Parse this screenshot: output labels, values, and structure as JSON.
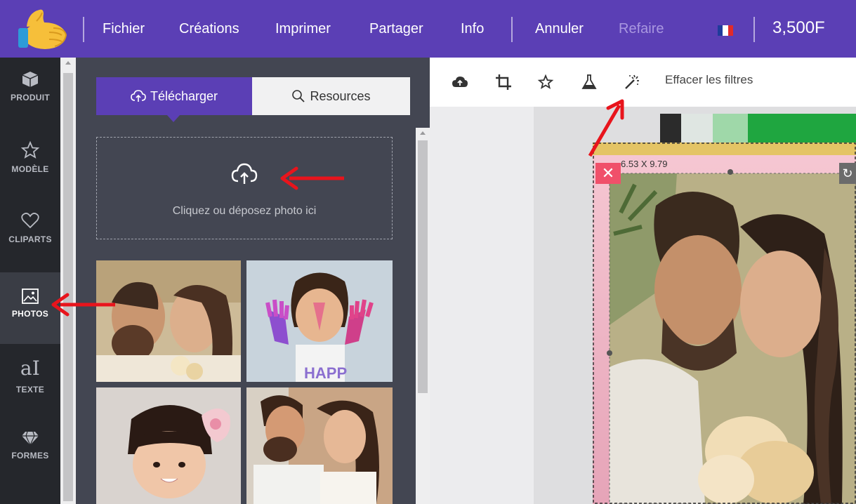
{
  "menu": {
    "file": "Fichier",
    "creations": "Créations",
    "print": "Imprimer",
    "share": "Partager",
    "info": "Info",
    "undo": "Annuler",
    "redo": "Refaire",
    "price": "3,500F"
  },
  "sidebar": {
    "items": [
      {
        "label": "PRODUIT",
        "icon": "cube-icon"
      },
      {
        "label": "MODÈLE",
        "icon": "star-outline-icon"
      },
      {
        "label": "CLIPARTS",
        "icon": "heart-outline-icon"
      },
      {
        "label": "PHOTOS",
        "icon": "image-icon",
        "active": true
      },
      {
        "label": "TEXTE",
        "icon": "text-icon"
      },
      {
        "label": "FORMES",
        "icon": "diamond-icon"
      }
    ]
  },
  "panel": {
    "tab_upload": "Télécharger",
    "tab_resources": "Resources",
    "dropzone_text": "Cliquez ou déposez photo ici"
  },
  "toolbar": {
    "clear_filters": "Effacer les filtres"
  },
  "canvas": {
    "size_label": "6.53 X 9.79"
  },
  "colors": {
    "brand": "#5b3fb5",
    "sidebar": "#25272c",
    "panel": "#434652",
    "arrow": "#e8141c"
  }
}
